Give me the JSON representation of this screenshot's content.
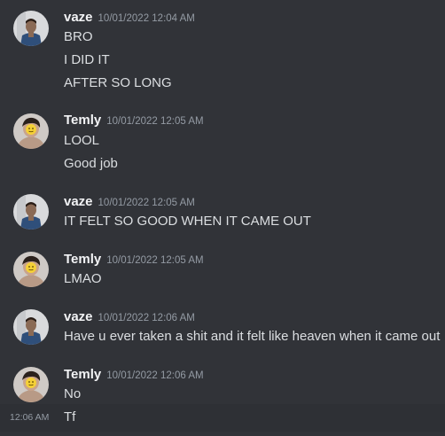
{
  "colors": {
    "background": "#313338",
    "hover_row": "#2e3035",
    "username": "#f2f3f5",
    "message_text": "#dbdee1",
    "timestamp": "#949ba4"
  },
  "groups": [
    {
      "author": "vaze",
      "avatar_icon": "vaze-avatar-icon",
      "timestamp": "10/01/2022 12:04 AM",
      "messages": [
        "BRO",
        "I DID IT",
        "AFTER SO LONG"
      ]
    },
    {
      "author": "Temly",
      "avatar_icon": "temly-avatar-icon",
      "timestamp": "10/01/2022 12:05 AM",
      "messages": [
        "LOOL",
        "Good job"
      ]
    },
    {
      "author": "vaze",
      "avatar_icon": "vaze-avatar-icon",
      "timestamp": "10/01/2022 12:05 AM",
      "messages": [
        "IT FELT SO GOOD WHEN IT CAME OUT"
      ]
    },
    {
      "author": "Temly",
      "avatar_icon": "temly-avatar-icon",
      "timestamp": "10/01/2022 12:05 AM",
      "messages": [
        "LMAO"
      ]
    },
    {
      "author": "vaze",
      "avatar_icon": "vaze-avatar-icon",
      "timestamp": "10/01/2022 12:06 AM",
      "messages": [
        "Have u ever taken a shit and it felt like heaven when it came out"
      ]
    },
    {
      "author": "Temly",
      "avatar_icon": "temly-avatar-icon",
      "timestamp": "10/01/2022 12:06 AM",
      "messages": [
        "No",
        "Tf"
      ]
    }
  ],
  "hovered_message_time": "12:06 AM"
}
